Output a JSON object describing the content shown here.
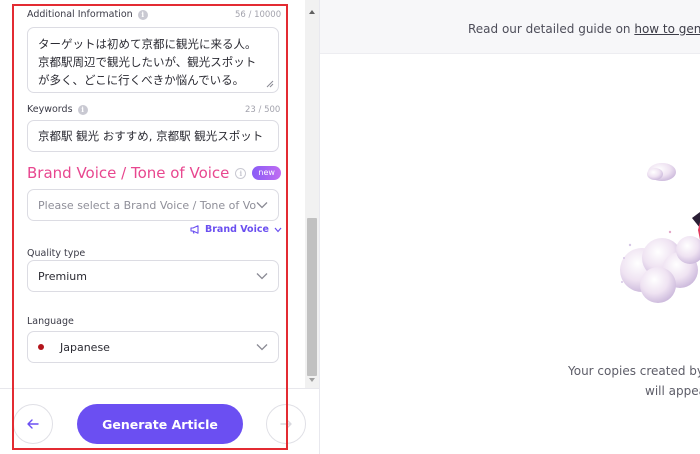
{
  "form": {
    "additional_info": {
      "label": "Additional Information",
      "counter": "56 / 10000",
      "value": "ターゲットは初めて京都に観光に来る人。\n京都駅周辺で観光したいが、観光スポット\nが多く、どこに行くべきか悩んでいる。"
    },
    "keywords": {
      "label": "Keywords",
      "counter": "23 / 500",
      "value": "京都駅 観光 おすすめ, 京都駅 観光スポット"
    },
    "brand_voice": {
      "heading": "Brand Voice / Tone of Voice",
      "badge": "new",
      "placeholder": "Please select a Brand Voice / Tone of Voi",
      "link_label": "Brand Voice"
    },
    "quality_type": {
      "label": "Quality type",
      "value": "Premium"
    },
    "language": {
      "label": "Language",
      "value": "Japanese"
    }
  },
  "footer": {
    "generate_label": "Generate Article",
    "back_icon": "arrow-left-icon",
    "next_icon": "arrow-right-icon"
  },
  "preview": {
    "guide_prefix": "Read our detailed guide on ",
    "guide_link": "how to gene",
    "empty_line1": "Your copies created by",
    "empty_line2": "will appea"
  },
  "colors": {
    "accent": "#6b4ff2",
    "brand_heading": "#e8478f",
    "highlight": "#e32b32"
  }
}
